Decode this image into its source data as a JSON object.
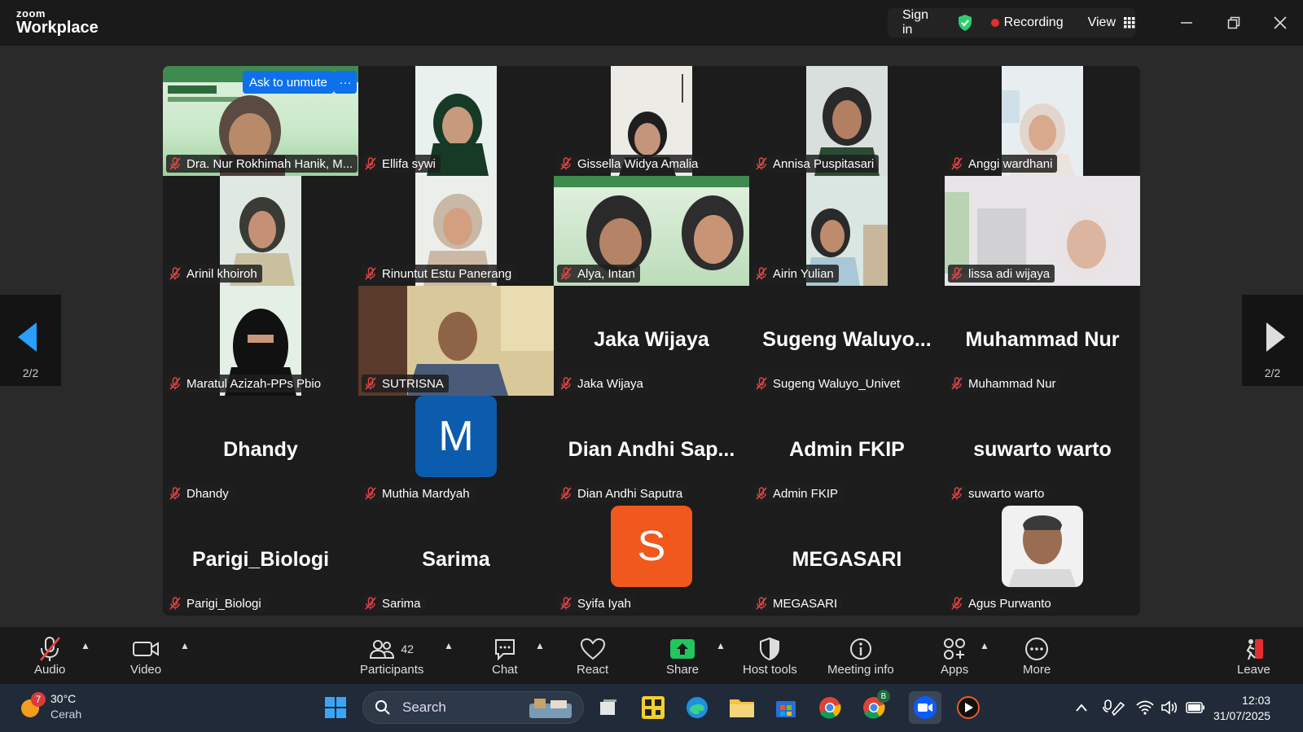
{
  "app": {
    "logo_top": "zoom",
    "logo_bottom": "Workplace"
  },
  "topbar": {
    "sign_in": "Sign in",
    "recording": "Recording",
    "view": "View"
  },
  "meeting": {
    "ask_to_unmute": "Ask to unmute",
    "more": "···",
    "page_left": "2/2",
    "page_right": "2/2",
    "participants": [
      {
        "name": "Dra. Nur Rokhimah Hanik, M...",
        "big": ""
      },
      {
        "name": "Ellifa sywi",
        "big": ""
      },
      {
        "name": "Gissella Widya Amalia",
        "big": ""
      },
      {
        "name": "Annisa Puspitasari",
        "big": ""
      },
      {
        "name": "Anggi wardhani",
        "big": ""
      },
      {
        "name": "Arinil khoiroh",
        "big": ""
      },
      {
        "name": "Rinuntut Estu Panerang",
        "big": ""
      },
      {
        "name": "Alya, Intan",
        "big": ""
      },
      {
        "name": "Airin Yulian",
        "big": ""
      },
      {
        "name": "lissa adi wijaya",
        "big": ""
      },
      {
        "name": "Maratul Azizah-PPs Pbio",
        "big": ""
      },
      {
        "name": "SUTRISNA",
        "big": ""
      },
      {
        "name": "Jaka Wijaya",
        "big": "Jaka Wijaya"
      },
      {
        "name": "Sugeng Waluyo_Univet",
        "big": "Sugeng  Waluyo..."
      },
      {
        "name": "Muhammad Nur",
        "big": "Muhammad Nur"
      },
      {
        "name": "Dhandy",
        "big": "Dhandy"
      },
      {
        "name": "Muthia Mardyah",
        "big": "",
        "letter": "M"
      },
      {
        "name": "Dian Andhi Saputra",
        "big": "Dian  Andhi  Sap..."
      },
      {
        "name": "Admin FKIP",
        "big": "Admin FKIP"
      },
      {
        "name": "suwarto warto",
        "big": "suwarto warto"
      },
      {
        "name": "Parigi_Biologi",
        "big": "Parigi_Biologi"
      },
      {
        "name": "Sarima",
        "big": "Sarima"
      },
      {
        "name": "Syifa Iyah",
        "big": "",
        "letter": "S"
      },
      {
        "name": "MEGASARI",
        "big": "MEGASARI"
      },
      {
        "name": "Agus Purwanto",
        "big": ""
      }
    ]
  },
  "toolbar": {
    "audio": "Audio",
    "video": "Video",
    "participants": "Participants",
    "participants_count": "42",
    "chat": "Chat",
    "react": "React",
    "share": "Share",
    "host_tools": "Host tools",
    "meeting_info": "Meeting info",
    "apps": "Apps",
    "more": "More",
    "leave": "Leave"
  },
  "taskbar": {
    "temp": "30°C",
    "condition": "Cerah",
    "weather_badge": "7",
    "search": "Search",
    "time": "12:03",
    "date": "31/07/2025",
    "chrome_badge": "B"
  },
  "colors": {
    "accent": "#0e71eb",
    "recording": "#e02f2f",
    "shield": "#2ecc71",
    "share": "#22c55e",
    "avatar_m": "#0b5cad",
    "avatar_s": "#f0581e"
  }
}
